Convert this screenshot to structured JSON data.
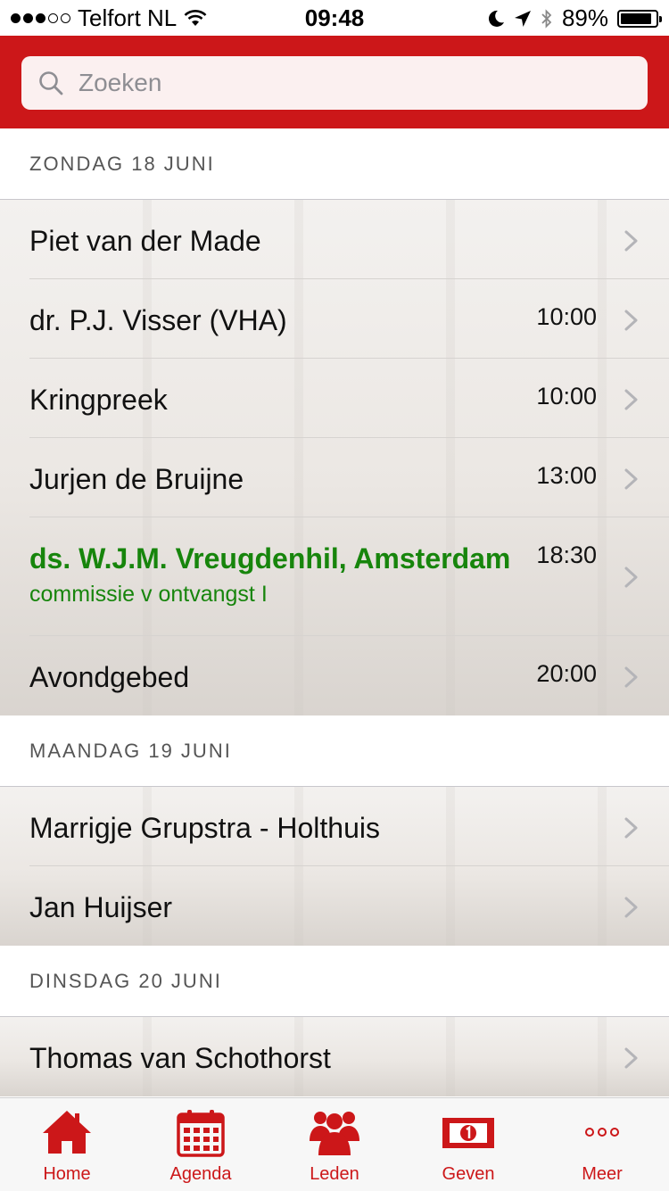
{
  "status_bar": {
    "carrier": "Telfort NL",
    "time": "09:48",
    "battery": "89%",
    "battery_level": 0.89
  },
  "search": {
    "placeholder": "Zoeken"
  },
  "sections": [
    {
      "header": "ZONDAG 18 JUNI",
      "rows": [
        {
          "title": "Piet van der Made",
          "time": ""
        },
        {
          "title": "dr. P.J. Visser (VHA)",
          "time": "10:00"
        },
        {
          "title": "Kringpreek",
          "time": "10:00"
        },
        {
          "title": "Jurjen de Bruijne",
          "time": "13:00"
        },
        {
          "title": "ds. W.J.M. Vreugdenhil, Amsterdam",
          "subtitle": "commissie v ontvangst I",
          "time": "18:30",
          "highlight": true
        },
        {
          "title": "Avondgebed",
          "time": "20:00"
        }
      ]
    },
    {
      "header": "MAANDAG 19 JUNI",
      "rows": [
        {
          "title": "Marrigje Grupstra - Holthuis",
          "time": ""
        },
        {
          "title": "Jan Huijser",
          "time": ""
        }
      ]
    },
    {
      "header": "DINSDAG 20 JUNI",
      "rows": [
        {
          "title": "Thomas van Schothorst",
          "time": ""
        }
      ]
    }
  ],
  "tabs": [
    {
      "label": "Home",
      "icon": "home-icon"
    },
    {
      "label": "Agenda",
      "icon": "calendar-icon"
    },
    {
      "label": "Leden",
      "icon": "members-icon"
    },
    {
      "label": "Geven",
      "icon": "banknote-icon"
    },
    {
      "label": "Meer",
      "icon": "more-icon"
    }
  ],
  "colors": {
    "accent": "#cc1719",
    "highlight_text": "#17850c"
  }
}
